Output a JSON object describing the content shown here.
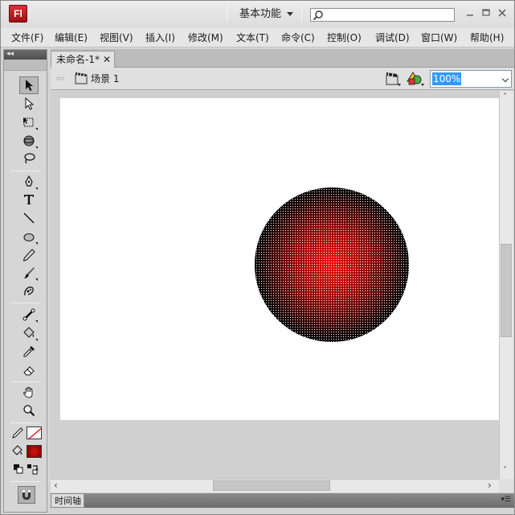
{
  "app": {
    "logo_text": "Fl",
    "workspace_label": "基本功能",
    "search_placeholder": ""
  },
  "menu": {
    "items": [
      {
        "label": "文件(F)"
      },
      {
        "label": "编辑(E)"
      },
      {
        "label": "视图(V)"
      },
      {
        "label": "插入(I)"
      },
      {
        "label": "修改(M)"
      },
      {
        "label": "文本(T)"
      },
      {
        "label": "命令(C)"
      },
      {
        "label": "控制(O)"
      },
      {
        "label": "调试(D)"
      },
      {
        "label": "窗口(W)"
      },
      {
        "label": "帮助(H)"
      }
    ]
  },
  "document": {
    "tab_title": "未命名-1*",
    "scene_label": "场景 1",
    "zoom": "100%"
  },
  "timeline": {
    "label": "时间轴"
  },
  "stage": {
    "background": "#ffffff",
    "shape": "circle",
    "fill_gradient": [
      "#e81818",
      "#000000"
    ]
  },
  "toolbox": {
    "stroke_color": "none",
    "fill_color": "#cc1010",
    "tools": [
      "selection-tool-icon",
      "subselection-tool-icon",
      "free-transform-tool-icon",
      "3d-rotation-tool-icon",
      "lasso-tool-icon",
      "pen-tool-icon",
      "text-tool-icon",
      "line-tool-icon",
      "oval-tool-icon",
      "pencil-tool-icon",
      "brush-tool-icon",
      "deco-tool-icon",
      "bone-tool-icon",
      "paint-bucket-tool-icon",
      "eyedropper-tool-icon",
      "eraser-tool-icon",
      "hand-tool-icon",
      "zoom-tool-icon"
    ]
  }
}
